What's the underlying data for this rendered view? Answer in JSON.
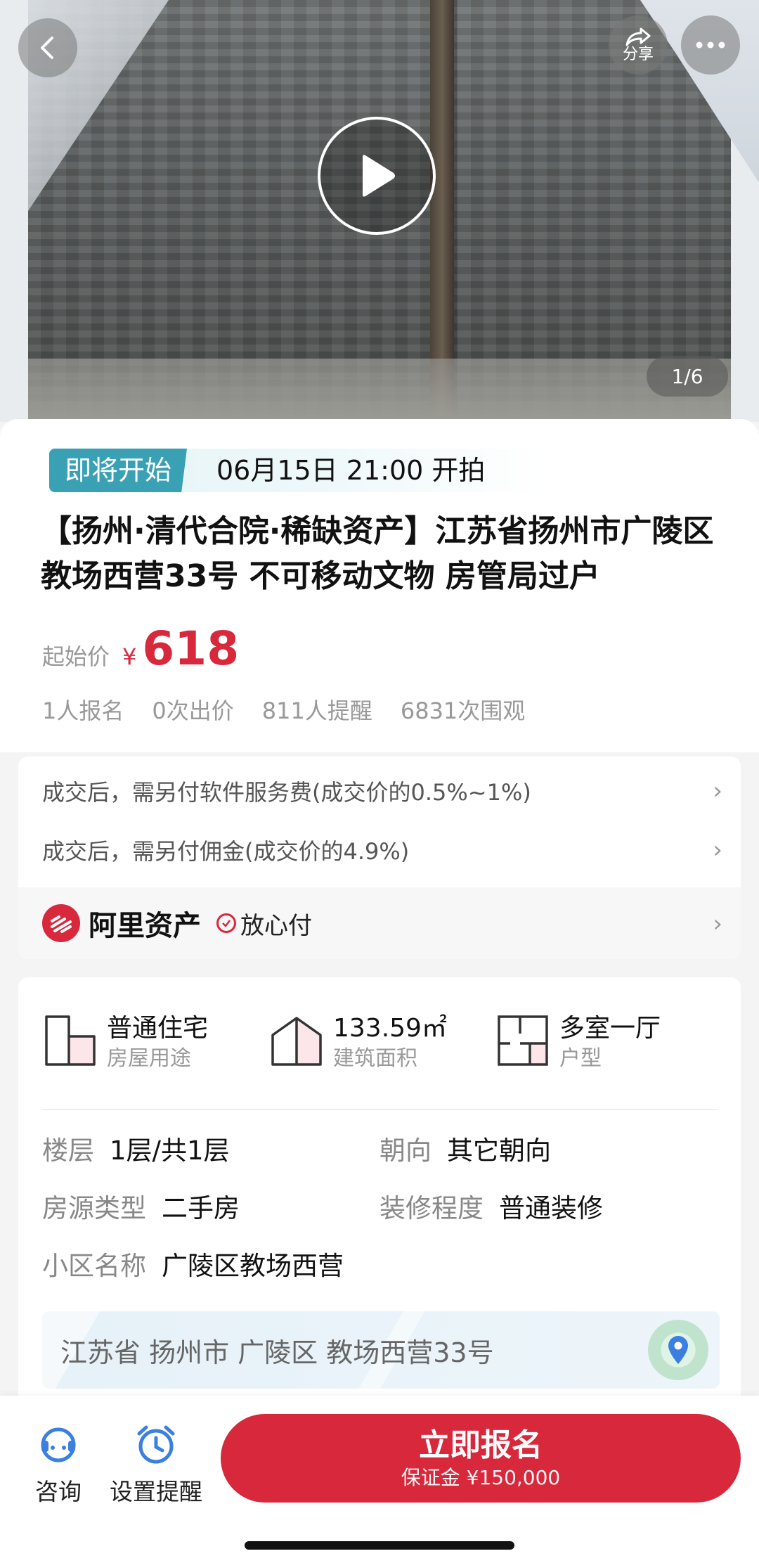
{
  "hero": {
    "share_label": "分享",
    "photo_counter": "1/6",
    "icons": [
      "back-arrow-icon",
      "share-icon",
      "more-icon",
      "play-icon"
    ]
  },
  "auction": {
    "status_badge": "即将开始",
    "start_time": "06月15日 21:00 开拍",
    "title": "【扬州·清代合院·稀缺资产】江苏省扬州市广陵区教场西营33号 不可移动文物 房管局过户",
    "price_label": "起始价",
    "currency": "¥",
    "price": "618",
    "stats": [
      "1人报名",
      "0次出价",
      "811人提醒",
      "6831次围观"
    ]
  },
  "fees": {
    "rows": [
      "成交后，需另付软件服务费(成交价的0.5%~1%)",
      "成交后，需另付佣金(成交价的4.9%)"
    ],
    "brand": "阿里资产",
    "tag": "放心付"
  },
  "property": {
    "features": [
      {
        "value": "普通住宅",
        "label": "房屋用途"
      },
      {
        "value": "133.59㎡",
        "label": "建筑面积"
      },
      {
        "value": "多室一厅",
        "label": "户型"
      }
    ],
    "attributes": [
      {
        "key": "楼层",
        "value": "1层/共1层"
      },
      {
        "key": "朝向",
        "value": "其它朝向"
      },
      {
        "key": "房源类型",
        "value": "二手房"
      },
      {
        "key": "装修程度",
        "value": "普通装修"
      },
      {
        "key": "小区名称",
        "value": "广陵区教场西营"
      }
    ],
    "address": "江苏省 扬州市 广陵区 教场西营33号"
  },
  "bottom_bar": {
    "consult_label": "咨询",
    "reminder_label": "设置提醒",
    "signup_label": "立即报名",
    "deposit": "保证金 ¥150,000"
  },
  "colors": {
    "accent_red": "#d7283c",
    "badge_teal": "#3aa0b4"
  }
}
